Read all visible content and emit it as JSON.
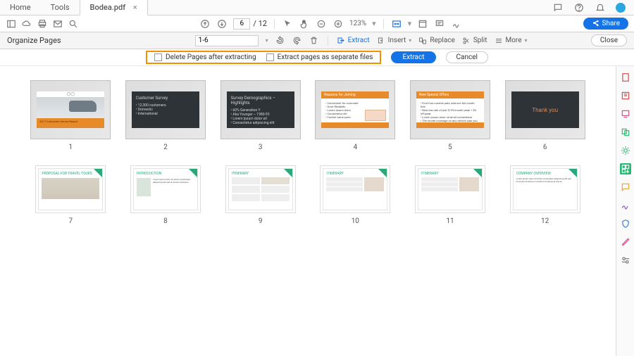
{
  "tabs": {
    "home": "Home",
    "tools": "Tools",
    "doc": "Bodea.pdf"
  },
  "toolbar": {
    "page_current": "6",
    "page_total": "/ 12",
    "zoom": "123%",
    "share": "Share"
  },
  "organize": {
    "title": "Organize Pages",
    "range": "1-6",
    "extract": "Extract",
    "insert": "Insert",
    "replace": "Replace",
    "split": "Split",
    "more": "More",
    "close": "Close"
  },
  "extract_bar": {
    "delete_after": "Delete Pages after extracting",
    "separate_files": "Extract pages as separate files",
    "extract_btn": "Extract",
    "cancel_btn": "Cancel"
  },
  "pages": [
    {
      "num": "1"
    },
    {
      "num": "2"
    },
    {
      "num": "3"
    },
    {
      "num": "4"
    },
    {
      "num": "5"
    },
    {
      "num": "6"
    },
    {
      "num": "7"
    },
    {
      "num": "8"
    },
    {
      "num": "9"
    },
    {
      "num": "10"
    },
    {
      "num": "11"
    },
    {
      "num": "12"
    }
  ],
  "slide_text": {
    "s2_title": "Customer Survey",
    "s3_title": "Survey Demographics – Highlights",
    "s4_title": "Reasons for Joining",
    "s5_title": "New Special Offers",
    "s6_title": "Thank you"
  }
}
